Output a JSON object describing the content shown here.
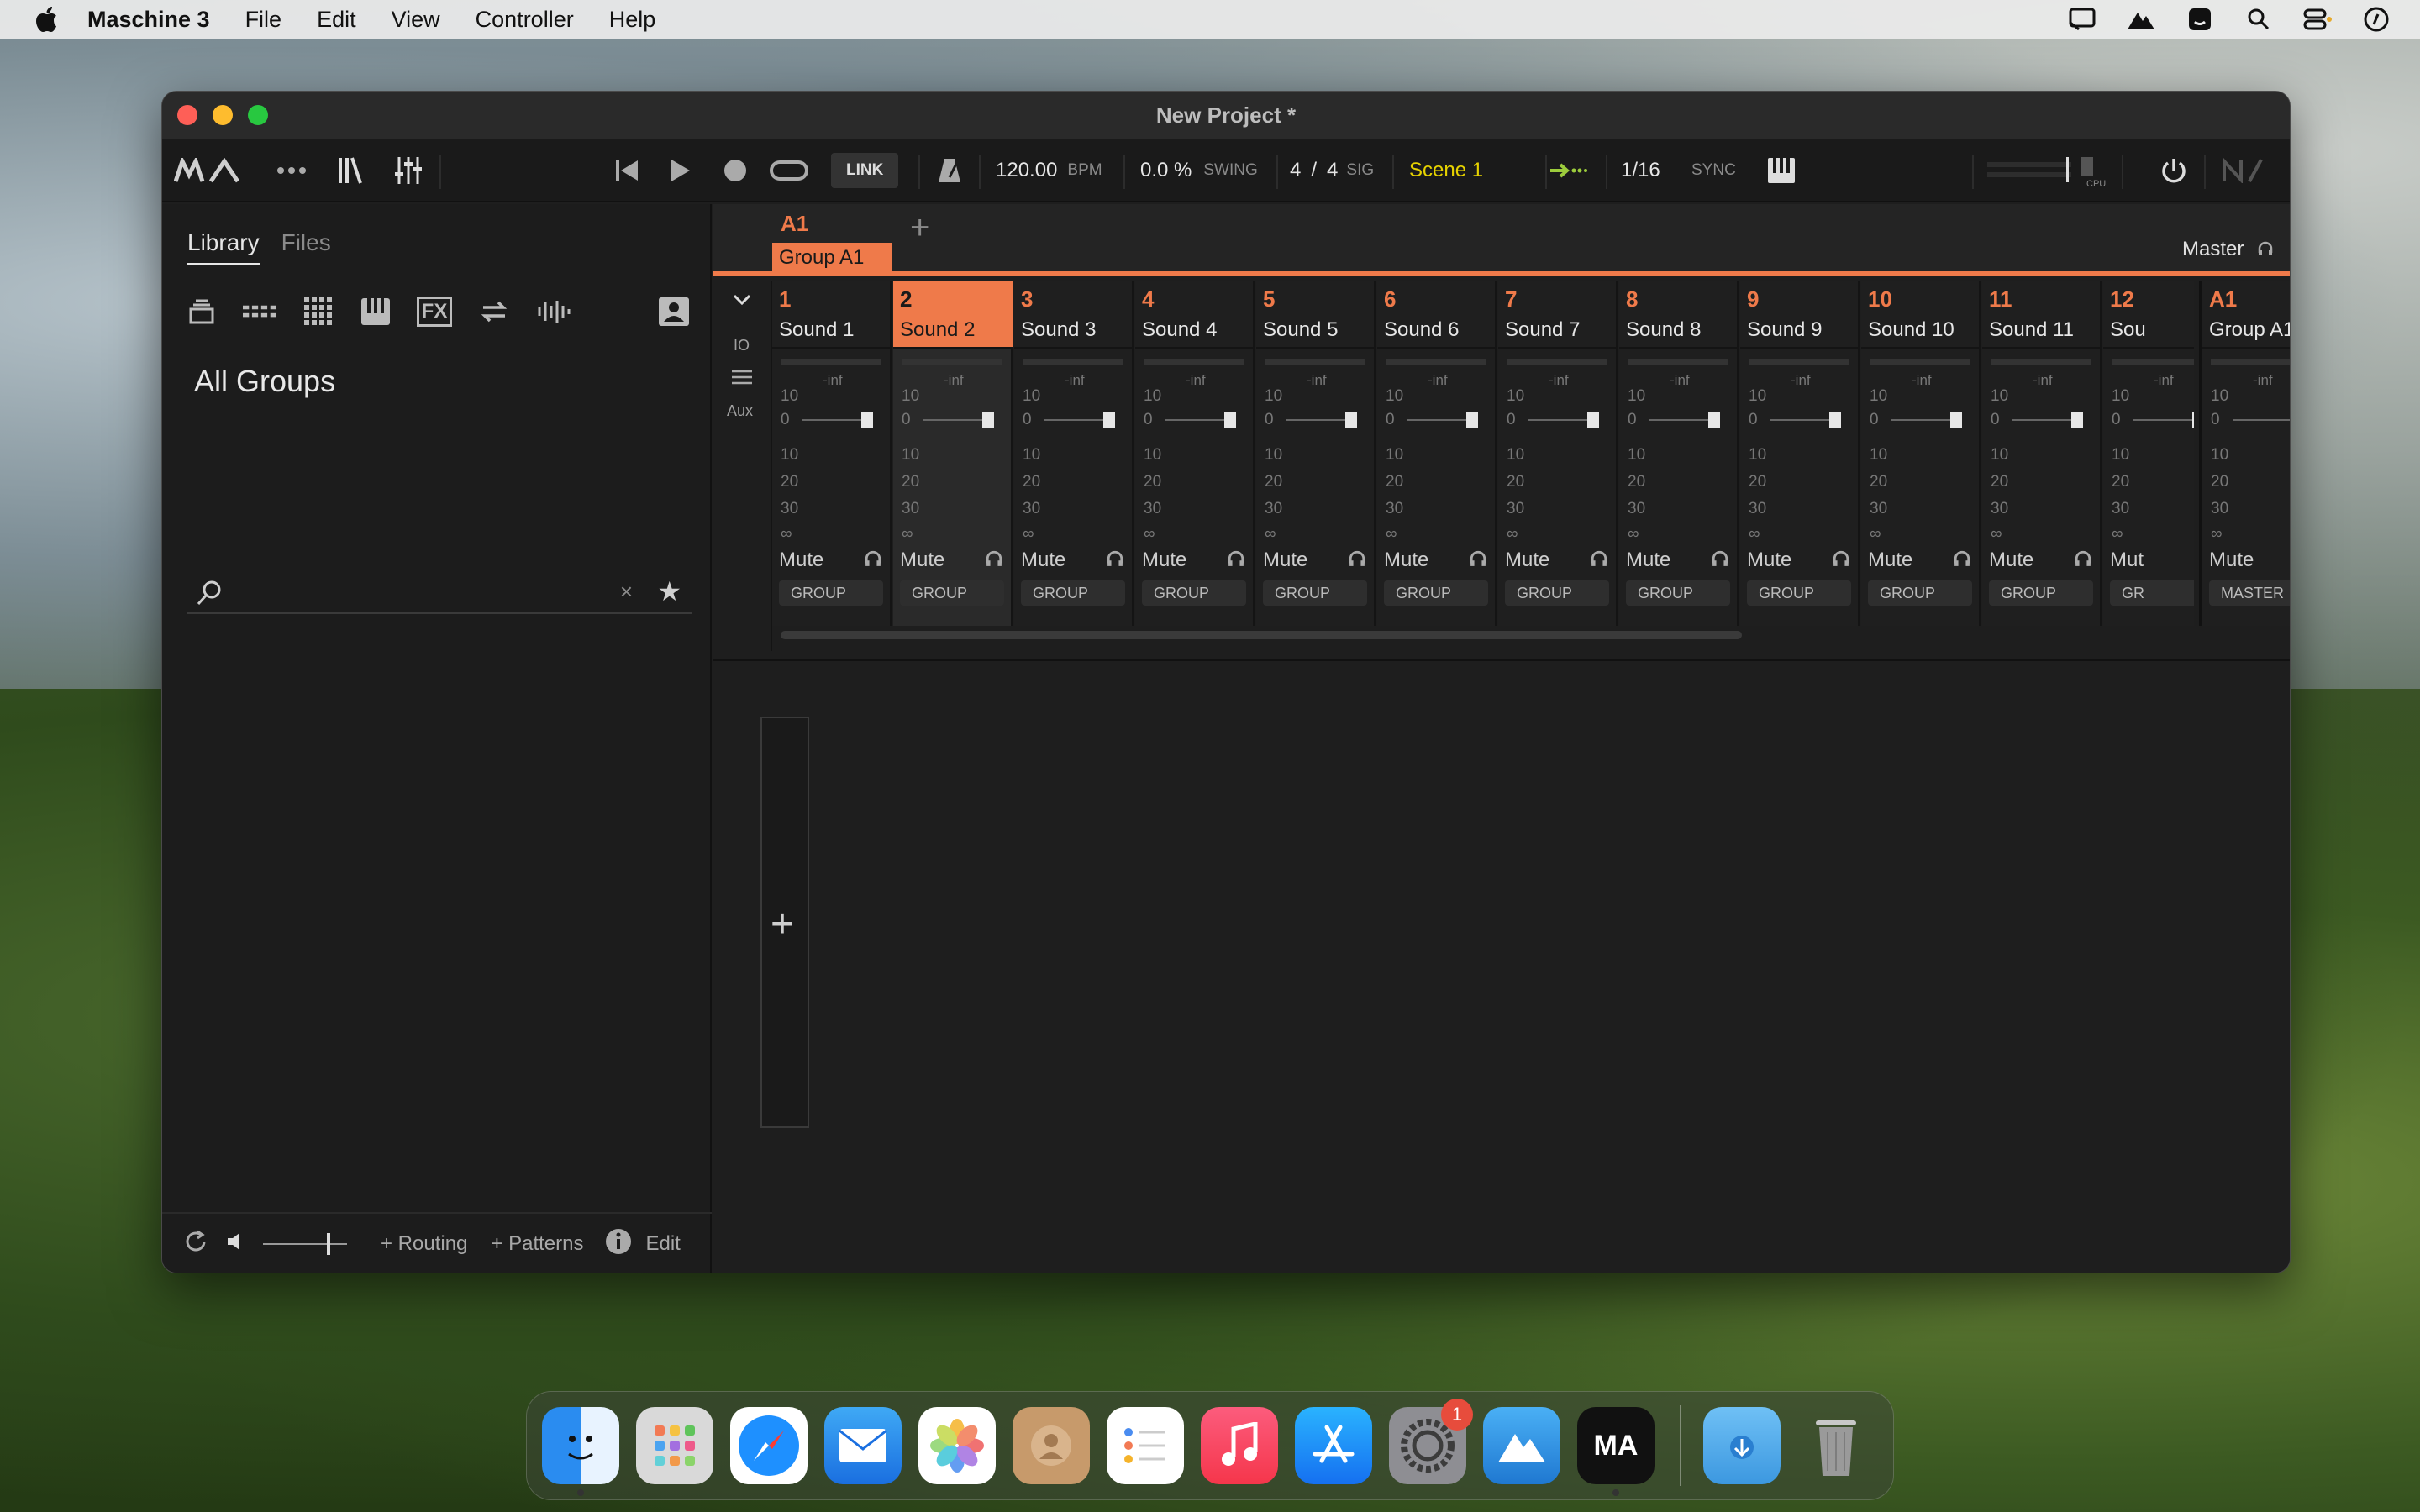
{
  "menubar": {
    "app_name": "Maschine 3",
    "items": [
      "File",
      "Edit",
      "View",
      "Controller",
      "Help"
    ],
    "status_icons": [
      "screen-mirror-icon",
      "hilltop-icon",
      "finder-icon",
      "search-icon",
      "control-center-icon",
      "siri-icon"
    ]
  },
  "window": {
    "title": "New Project *"
  },
  "transport": {
    "link_label": "LINK",
    "tempo": "120.00",
    "tempo_unit": "BPM",
    "swing": "0.0 %",
    "swing_label": "SWING",
    "sig_num": "4",
    "sig_slash": "/",
    "sig_den": "4",
    "sig_label": "SIG",
    "scene": "Scene 1",
    "quantize": "1/16",
    "sync_label": "SYNC",
    "cpu_label": "CPU"
  },
  "browser": {
    "tabs": [
      "Library",
      "Files"
    ],
    "title": "All Groups",
    "category_icons": [
      "group-icon",
      "patterns-icon",
      "kit-icon",
      "instrument-icon",
      "effect-icon",
      "loop-icon",
      "sample-icon",
      "user-icon"
    ],
    "fx_label": "FX",
    "search_placeholder": "",
    "clear_label": "×",
    "bottom": {
      "routing": "+ Routing",
      "patterns": "+ Patterns",
      "edit": "Edit"
    }
  },
  "mixer": {
    "group_id": "A1",
    "group_name": "Group A1",
    "add_label": "+",
    "master_label": "Master",
    "left_controls": [
      "IO",
      "Aux"
    ],
    "channels": [
      {
        "num": "1",
        "name": "Sound 1"
      },
      {
        "num": "2",
        "name": "Sound 2"
      },
      {
        "num": "3",
        "name": "Sound 3"
      },
      {
        "num": "4",
        "name": "Sound 4"
      },
      {
        "num": "5",
        "name": "Sound 5"
      },
      {
        "num": "6",
        "name": "Sound 6"
      },
      {
        "num": "7",
        "name": "Sound 7"
      },
      {
        "num": "8",
        "name": "Sound 8"
      },
      {
        "num": "9",
        "name": "Sound 9"
      },
      {
        "num": "10",
        "name": "Sound 10"
      },
      {
        "num": "11",
        "name": "Sound 11"
      },
      {
        "num": "12",
        "name": "Sou"
      }
    ],
    "selected_channel": 2,
    "master_channel": {
      "num": "A1",
      "name": "Group A1",
      "button": "MASTER"
    },
    "scale": [
      "-inf",
      "10",
      "0",
      "10",
      "20",
      "30",
      "∞"
    ],
    "mute_label": "Mute",
    "group_button": "GROUP",
    "last_mute_label": "Mut",
    "last_group_button": "GR"
  },
  "pattern": {
    "add_label": "+"
  },
  "dock": {
    "apps": [
      "finder-icon",
      "launchpad-icon",
      "safari-icon",
      "mail-icon",
      "photos-icon",
      "contacts-icon",
      "reminders-icon",
      "music-icon",
      "app-store-icon",
      "system-settings-icon",
      "hilltop-app-icon",
      "maschine-icon"
    ],
    "settings_badge": "1",
    "right": [
      "downloads-folder-icon",
      "trash-icon"
    ],
    "maschine_label": "MA"
  },
  "colors": {
    "accent": "#ef7a4a",
    "scene": "#e6d200",
    "quantize_arrow": "#9ccc3c"
  }
}
